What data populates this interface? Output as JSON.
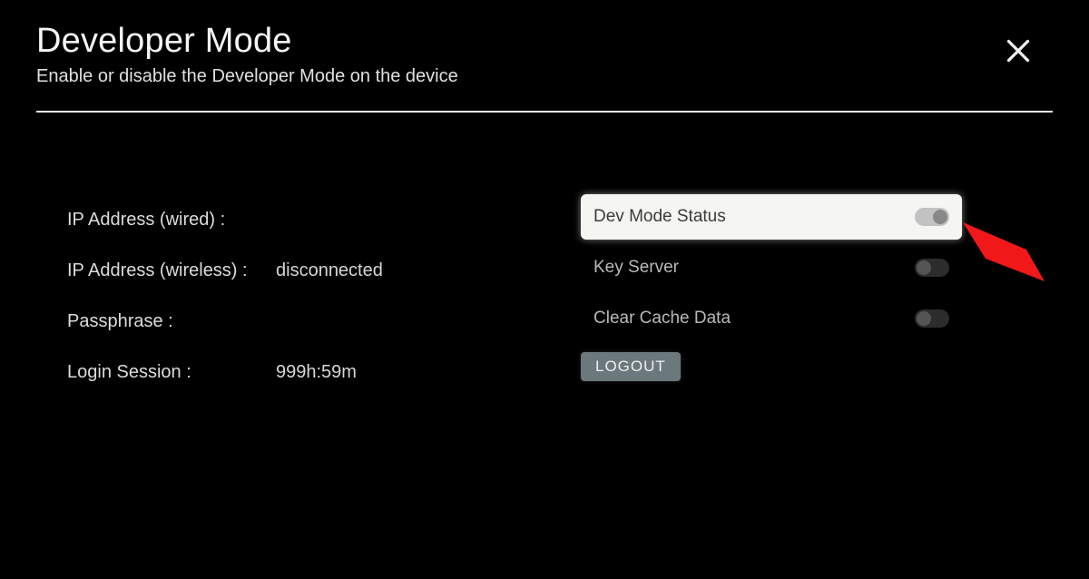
{
  "header": {
    "title": "Developer Mode",
    "subtitle": "Enable or disable the Developer Mode on the device"
  },
  "info": {
    "ip_wired_label": "IP Address (wired) :",
    "ip_wired_value": "",
    "ip_wireless_label": "IP Address (wireless) :",
    "ip_wireless_value": "disconnected",
    "passphrase_label": "Passphrase :",
    "passphrase_value": "",
    "session_label": "Login Session :",
    "session_value": "999h:59m"
  },
  "settings": {
    "dev_mode_label": "Dev Mode Status",
    "key_server_label": "Key Server",
    "clear_cache_label": "Clear Cache Data"
  },
  "buttons": {
    "logout": "LOGOUT"
  }
}
